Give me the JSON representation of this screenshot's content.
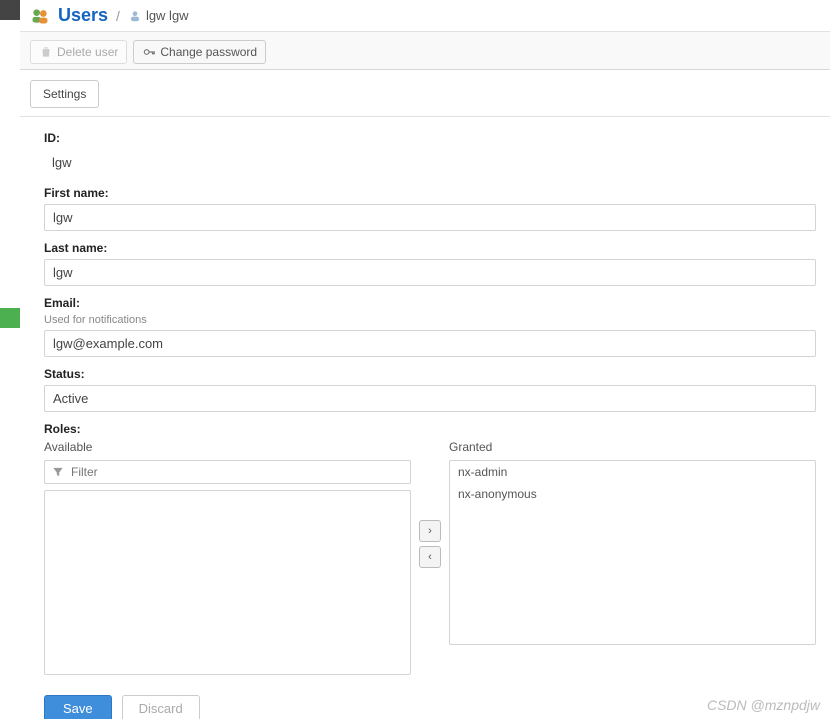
{
  "breadcrumb": {
    "root": "Users",
    "separator": "/",
    "current": "lgw lgw"
  },
  "toolbar": {
    "delete_label": "Delete user",
    "change_pw_label": "Change password"
  },
  "tabs": {
    "settings": "Settings"
  },
  "form": {
    "id_label": "ID:",
    "id_value": "lgw",
    "firstname_label": "First name:",
    "firstname_value": "lgw",
    "lastname_label": "Last name:",
    "lastname_value": "lgw",
    "email_label": "Email:",
    "email_help": "Used for notifications",
    "email_value": "lgw@example.com",
    "status_label": "Status:",
    "status_value": "Active",
    "roles_label": "Roles:",
    "available_label": "Available",
    "granted_label": "Granted",
    "filter_placeholder": "Filter",
    "granted_roles": [
      "nx-admin",
      "nx-anonymous"
    ]
  },
  "actions": {
    "save": "Save",
    "discard": "Discard"
  },
  "watermark": "CSDN @mznpdjw"
}
